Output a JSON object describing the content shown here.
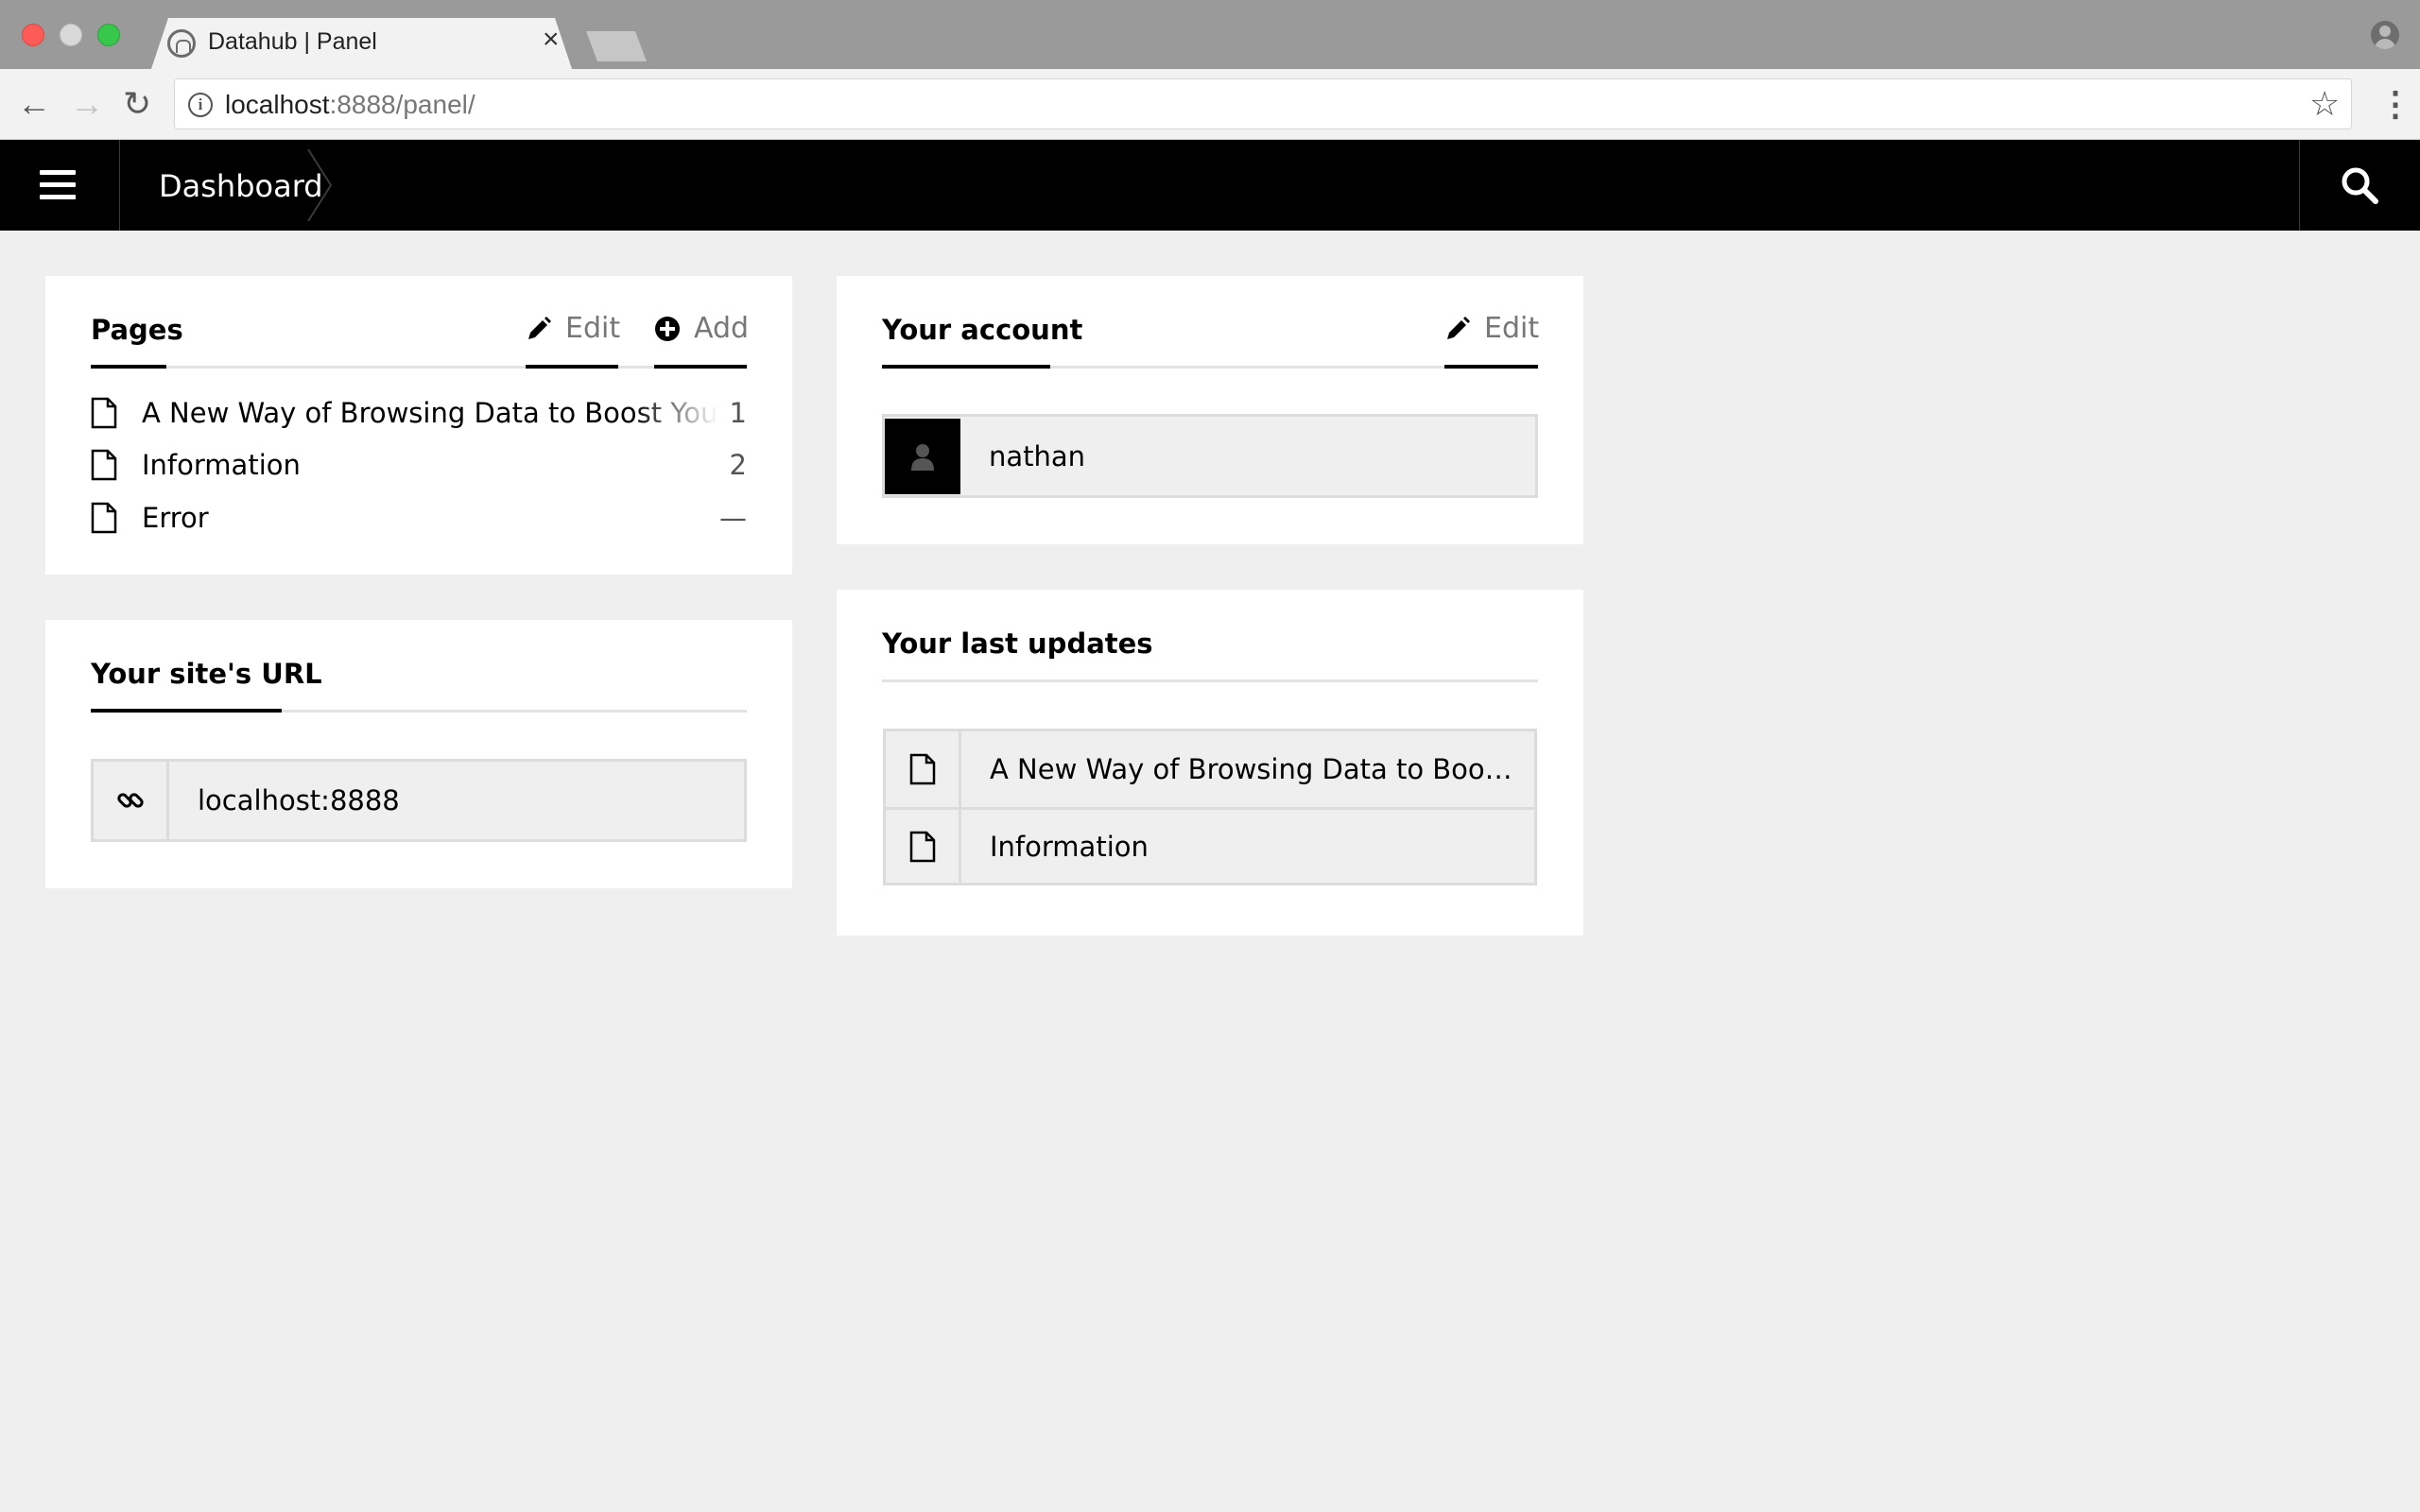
{
  "browser": {
    "tab_title": "Datahub | Panel",
    "tab_close": "×",
    "url_host": "localhost",
    "url_rest": ":8888/panel/",
    "icons": [
      "back-arrow-icon",
      "forward-arrow-icon",
      "reload-icon",
      "info-icon",
      "star-icon",
      "menu-dots-icon",
      "profile-icon"
    ]
  },
  "appbar": {
    "breadcrumb": "Dashboard"
  },
  "pages_widget": {
    "title": "Pages",
    "edit_label": "Edit",
    "add_label": "Add",
    "items": [
      {
        "title": "A New Way of Browsing Data to Boost Your Research",
        "number": "1"
      },
      {
        "title": "Information",
        "number": "2"
      },
      {
        "title": "Error",
        "number": "—"
      }
    ]
  },
  "site_url_widget": {
    "title": "Your site's URL",
    "url": "localhost:8888"
  },
  "account_widget": {
    "title": "Your account",
    "edit_label": "Edit",
    "username": "nathan"
  },
  "updates_widget": {
    "title": "Your last updates",
    "items": [
      {
        "title": "A New Way of Browsing Data to Boost Your Research"
      },
      {
        "title": "Information"
      }
    ]
  },
  "colors": {
    "appbar": "#000000",
    "background": "#efefef",
    "card": "#ffffff",
    "muted_text": "#777777"
  }
}
